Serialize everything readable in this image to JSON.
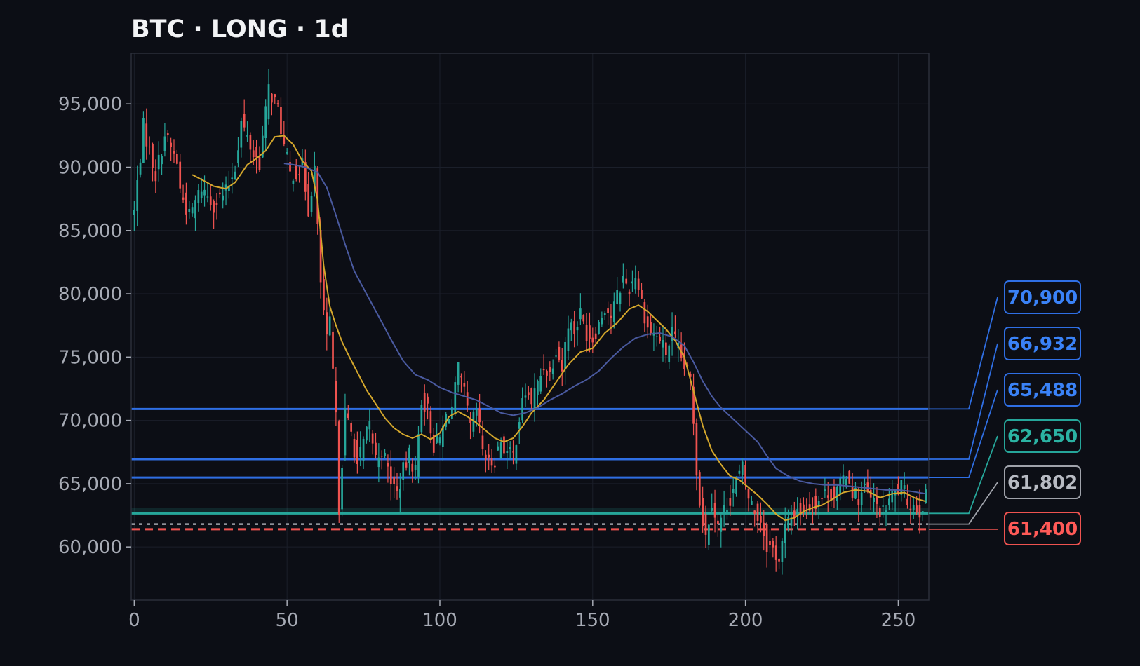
{
  "chart_data": {
    "type": "candlestick",
    "title": "BTC · LONG · 1d",
    "xlabel": "",
    "ylabel": "",
    "xlim": [
      -1,
      260
    ],
    "ylim": [
      55800,
      99000
    ],
    "x_ticks": [
      0,
      50,
      100,
      150,
      200,
      250
    ],
    "y_ticks": [
      60000,
      65000,
      70000,
      75000,
      80000,
      85000,
      90000,
      95000
    ],
    "grid": true,
    "candle_colors": {
      "up": "#26a69a",
      "down": "#ef5350"
    },
    "close_path": [
      [
        0,
        86500
      ],
      [
        3,
        93200
      ],
      [
        7,
        89400
      ],
      [
        10,
        92600
      ],
      [
        14,
        90400
      ],
      [
        15,
        88200
      ],
      [
        18,
        86100
      ],
      [
        22,
        88400
      ],
      [
        26,
        87100
      ],
      [
        30,
        88000
      ],
      [
        33,
        90100
      ],
      [
        35,
        93600
      ],
      [
        39,
        91000
      ],
      [
        41,
        90400
      ],
      [
        44,
        96200
      ],
      [
        47,
        94600
      ],
      [
        49,
        91600
      ],
      [
        51,
        89400
      ],
      [
        55,
        90000
      ],
      [
        57,
        86700
      ],
      [
        59,
        89900
      ],
      [
        60,
        85000
      ],
      [
        61,
        80900
      ],
      [
        63,
        76200
      ],
      [
        64,
        77600
      ],
      [
        66,
        70000
      ],
      [
        67,
        63200
      ],
      [
        69,
        70500
      ],
      [
        71,
        69000
      ],
      [
        73,
        66500
      ],
      [
        75,
        68200
      ],
      [
        77,
        69600
      ],
      [
        79,
        67000
      ],
      [
        81,
        67700
      ],
      [
        84,
        65300
      ],
      [
        86,
        64200
      ],
      [
        88,
        66000
      ],
      [
        90,
        67200
      ],
      [
        92,
        66000
      ],
      [
        94,
        71700
      ],
      [
        96,
        70800
      ],
      [
        98,
        68000
      ],
      [
        100,
        68500
      ],
      [
        102,
        70300
      ],
      [
        104,
        71000
      ],
      [
        106,
        73900
      ],
      [
        108,
        72000
      ],
      [
        110,
        69400
      ],
      [
        112,
        70800
      ],
      [
        114,
        67800
      ],
      [
        116,
        66500
      ],
      [
        118,
        67000
      ],
      [
        120,
        68400
      ],
      [
        122,
        67400
      ],
      [
        124,
        67200
      ],
      [
        126,
        70200
      ],
      [
        128,
        72200
      ],
      [
        130,
        71500
      ],
      [
        132,
        72800
      ],
      [
        134,
        74300
      ],
      [
        136,
        73700
      ],
      [
        138,
        75800
      ],
      [
        140,
        74100
      ],
      [
        142,
        77800
      ],
      [
        144,
        77100
      ],
      [
        146,
        78400
      ],
      [
        148,
        76900
      ],
      [
        150,
        76500
      ],
      [
        152,
        77700
      ],
      [
        154,
        79000
      ],
      [
        156,
        78200
      ],
      [
        158,
        79800
      ],
      [
        160,
        81200
      ],
      [
        162,
        80400
      ],
      [
        164,
        81600
      ],
      [
        166,
        79400
      ],
      [
        168,
        77300
      ],
      [
        170,
        76800
      ],
      [
        172,
        76400
      ],
      [
        174,
        75300
      ],
      [
        176,
        76900
      ],
      [
        178,
        75500
      ],
      [
        180,
        74200
      ],
      [
        182,
        73200
      ],
      [
        183,
        70000
      ],
      [
        184,
        66200
      ],
      [
        185,
        63600
      ],
      [
        186,
        62100
      ],
      [
        187,
        60800
      ],
      [
        189,
        63700
      ],
      [
        191,
        61600
      ],
      [
        193,
        62900
      ],
      [
        195,
        63900
      ],
      [
        197,
        65200
      ],
      [
        199,
        66200
      ],
      [
        201,
        63900
      ],
      [
        203,
        62800
      ],
      [
        205,
        62100
      ],
      [
        207,
        60200
      ],
      [
        209,
        59800
      ],
      [
        211,
        59000
      ],
      [
        213,
        61500
      ],
      [
        215,
        62300
      ],
      [
        217,
        63100
      ],
      [
        219,
        62600
      ],
      [
        221,
        63200
      ],
      [
        223,
        63600
      ],
      [
        225,
        63900
      ],
      [
        227,
        64400
      ],
      [
        229,
        64100
      ],
      [
        231,
        64800
      ],
      [
        233,
        65900
      ],
      [
        235,
        64500
      ],
      [
        237,
        63800
      ],
      [
        239,
        64600
      ],
      [
        241,
        63700
      ],
      [
        243,
        63200
      ],
      [
        245,
        62600
      ],
      [
        247,
        63700
      ],
      [
        249,
        64300
      ],
      [
        251,
        64700
      ],
      [
        253,
        63700
      ],
      [
        255,
        63300
      ],
      [
        257,
        62900
      ],
      [
        259,
        63900
      ]
    ],
    "moving_averages": [
      {
        "color": "#d4a72c",
        "points": [
          [
            19,
            89400
          ],
          [
            23,
            88900
          ],
          [
            26,
            88500
          ],
          [
            30,
            88300
          ],
          [
            33,
            88800
          ],
          [
            37,
            90200
          ],
          [
            40,
            90700
          ],
          [
            43,
            91300
          ],
          [
            46,
            92400
          ],
          [
            49,
            92500
          ],
          [
            52,
            91800
          ],
          [
            55,
            90500
          ],
          [
            58,
            89700
          ],
          [
            60,
            87400
          ],
          [
            62,
            82200
          ],
          [
            64,
            79000
          ],
          [
            66,
            77500
          ],
          [
            68,
            76200
          ],
          [
            70,
            75200
          ],
          [
            73,
            73800
          ],
          [
            76,
            72400
          ],
          [
            79,
            71300
          ],
          [
            82,
            70200
          ],
          [
            85,
            69400
          ],
          [
            88,
            68900
          ],
          [
            91,
            68600
          ],
          [
            94,
            68900
          ],
          [
            97,
            68500
          ],
          [
            100,
            69000
          ],
          [
            103,
            70300
          ],
          [
            106,
            70700
          ],
          [
            109,
            70300
          ],
          [
            112,
            69800
          ],
          [
            115,
            69200
          ],
          [
            118,
            68600
          ],
          [
            121,
            68300
          ],
          [
            124,
            68600
          ],
          [
            127,
            69500
          ],
          [
            130,
            70600
          ],
          [
            134,
            71600
          ],
          [
            138,
            73000
          ],
          [
            142,
            74400
          ],
          [
            146,
            75400
          ],
          [
            150,
            75700
          ],
          [
            154,
            76900
          ],
          [
            158,
            77700
          ],
          [
            162,
            78800
          ],
          [
            165,
            79100
          ],
          [
            168,
            78600
          ],
          [
            171,
            77900
          ],
          [
            174,
            77200
          ],
          [
            177,
            76300
          ],
          [
            180,
            75000
          ],
          [
            183,
            72300
          ],
          [
            186,
            69600
          ],
          [
            189,
            67600
          ],
          [
            192,
            66500
          ],
          [
            195,
            65600
          ],
          [
            198,
            65300
          ],
          [
            201,
            64700
          ],
          [
            204,
            64100
          ],
          [
            207,
            63400
          ],
          [
            210,
            62600
          ],
          [
            213,
            62100
          ],
          [
            216,
            62300
          ],
          [
            219,
            62800
          ],
          [
            222,
            63100
          ],
          [
            225,
            63300
          ],
          [
            228,
            63700
          ],
          [
            232,
            64300
          ],
          [
            236,
            64500
          ],
          [
            240,
            64400
          ],
          [
            244,
            63900
          ],
          [
            248,
            64200
          ],
          [
            252,
            64300
          ],
          [
            256,
            63800
          ],
          [
            259,
            63600
          ]
        ]
      },
      {
        "color": "#4a5aa0",
        "points": [
          [
            49,
            90300
          ],
          [
            52,
            90200
          ],
          [
            56,
            90000
          ],
          [
            60,
            89600
          ],
          [
            63,
            88400
          ],
          [
            66,
            86200
          ],
          [
            69,
            83900
          ],
          [
            72,
            81800
          ],
          [
            76,
            80000
          ],
          [
            80,
            78200
          ],
          [
            84,
            76400
          ],
          [
            88,
            74700
          ],
          [
            92,
            73600
          ],
          [
            96,
            73200
          ],
          [
            100,
            72600
          ],
          [
            104,
            72200
          ],
          [
            108,
            71900
          ],
          [
            112,
            71600
          ],
          [
            116,
            71100
          ],
          [
            120,
            70600
          ],
          [
            124,
            70400
          ],
          [
            128,
            70600
          ],
          [
            132,
            71000
          ],
          [
            136,
            71600
          ],
          [
            140,
            72100
          ],
          [
            144,
            72700
          ],
          [
            148,
            73200
          ],
          [
            152,
            73900
          ],
          [
            156,
            74900
          ],
          [
            160,
            75800
          ],
          [
            164,
            76500
          ],
          [
            168,
            76800
          ],
          [
            172,
            76900
          ],
          [
            176,
            76600
          ],
          [
            180,
            75900
          ],
          [
            183,
            74600
          ],
          [
            186,
            73100
          ],
          [
            189,
            71900
          ],
          [
            192,
            71000
          ],
          [
            196,
            70100
          ],
          [
            200,
            69200
          ],
          [
            204,
            68300
          ],
          [
            207,
            67200
          ],
          [
            210,
            66200
          ],
          [
            214,
            65600
          ],
          [
            218,
            65200
          ],
          [
            222,
            65000
          ],
          [
            226,
            64900
          ],
          [
            230,
            64900
          ],
          [
            234,
            64800
          ],
          [
            238,
            64700
          ],
          [
            242,
            64600
          ],
          [
            246,
            64500
          ],
          [
            250,
            64500
          ],
          [
            254,
            64400
          ],
          [
            259,
            64200
          ]
        ]
      }
    ],
    "levels": [
      {
        "label": "70,900",
        "value": 70900,
        "color": "#2f6fe4",
        "style": "solid"
      },
      {
        "label": "66,932",
        "value": 66932,
        "color": "#2f6fe4",
        "style": "solid"
      },
      {
        "label": "65,488",
        "value": 65488,
        "color": "#2f6fe4",
        "style": "solid"
      },
      {
        "label": "62,650",
        "value": 62650,
        "color": "#26a69a",
        "style": "solid"
      },
      {
        "label": "61,802",
        "value": 61802,
        "color": "#a0a3ab",
        "style": "dotted"
      },
      {
        "label": "61,400",
        "value": 61400,
        "color": "#ef5350",
        "style": "dashed"
      }
    ],
    "label_text_colors": [
      "#3a82f7",
      "#3a82f7",
      "#3a82f7",
      "#2bb3a3",
      "#b8bbc3",
      "#ff5a57"
    ],
    "entry_band": [
      62550,
      63100
    ],
    "colors": {
      "background": "#0c0e15",
      "grid": "#1b1f2a",
      "axes": "#2b2f3a"
    }
  }
}
